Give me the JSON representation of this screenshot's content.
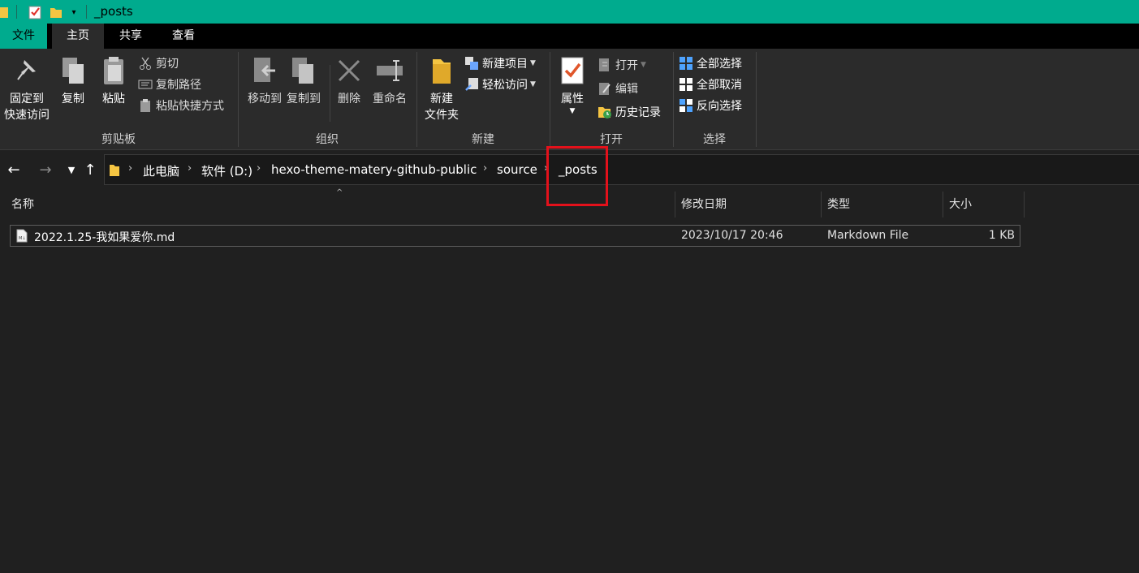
{
  "window": {
    "title": "_posts"
  },
  "ribbon_tabs": [
    {
      "label": "文件"
    },
    {
      "label": "主页"
    },
    {
      "label": "共享"
    },
    {
      "label": "查看"
    }
  ],
  "ribbon": {
    "clipboard": {
      "label": "剪贴板",
      "pin_line1": "固定到",
      "pin_line2": "快速访问",
      "copy": "复制",
      "paste": "粘贴",
      "cut": "剪切",
      "copy_path": "复制路径",
      "paste_shortcut": "粘贴快捷方式"
    },
    "organize": {
      "label": "组织",
      "move_to": "移动到",
      "copy_to": "复制到",
      "delete": "删除",
      "rename": "重命名"
    },
    "new": {
      "label": "新建",
      "new_folder_line1": "新建",
      "new_folder_line2": "文件夹",
      "new_item": "新建项目",
      "easy_access": "轻松访问"
    },
    "open": {
      "label": "打开",
      "properties": "属性",
      "open": "打开",
      "edit": "编辑",
      "history": "历史记录"
    },
    "select": {
      "label": "选择",
      "select_all": "全部选择",
      "select_none": "全部取消",
      "invert": "反向选择"
    }
  },
  "address": {
    "breadcrumbs": [
      "此电脑",
      "软件 (D:)",
      "hexo-theme-matery-github-public",
      "source",
      "_posts"
    ]
  },
  "columns": {
    "name": "名称",
    "modified": "修改日期",
    "type": "类型",
    "size": "大小"
  },
  "files": [
    {
      "name": "2022.1.25-我如果爱你.md",
      "modified": "2023/10/17 20:46",
      "type": "Markdown File",
      "size": "1 KB"
    }
  ],
  "colors": {
    "titlebar": "#00ab8e",
    "background": "#202020",
    "ribbon": "#2b2b2b",
    "highlight_box": "#e3111b"
  }
}
